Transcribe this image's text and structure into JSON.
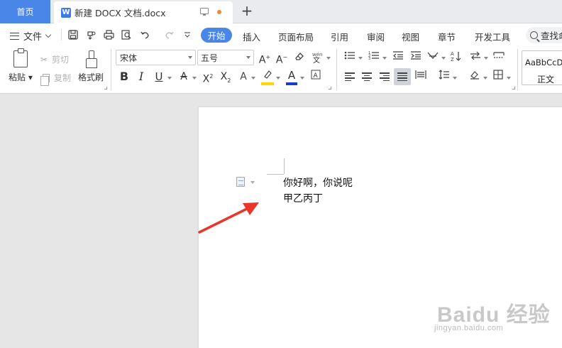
{
  "tabs": {
    "home": "首页",
    "document": "新建 DOCX 文档.docx",
    "doc_icon_letter": "W",
    "new_tab": "+"
  },
  "menu": {
    "file": "文件",
    "items": [
      "开始",
      "插入",
      "页面布局",
      "引用",
      "审阅",
      "视图",
      "章节",
      "开发工具"
    ],
    "search": "查找命"
  },
  "ribbon": {
    "paste": "粘贴",
    "cut": "剪切",
    "copy": "复制",
    "format_painter": "格式刷",
    "font_name": "宋体",
    "font_size": "五号",
    "style_sample": "AaBbCcDd",
    "style_name": "正文",
    "active_tab": "开始"
  },
  "colors": {
    "accent": "#4a86e8",
    "highlight": "#ffd700",
    "font_color": "#1a3ccc",
    "arrow": "#e8372a",
    "unsaved_dot": "#f0883a"
  },
  "document": {
    "lines": [
      "你好啊，你说呢",
      "甲乙丙丁"
    ]
  },
  "watermark": {
    "logo": "Baidu 经验",
    "url": "jingyan.baidu.com"
  }
}
